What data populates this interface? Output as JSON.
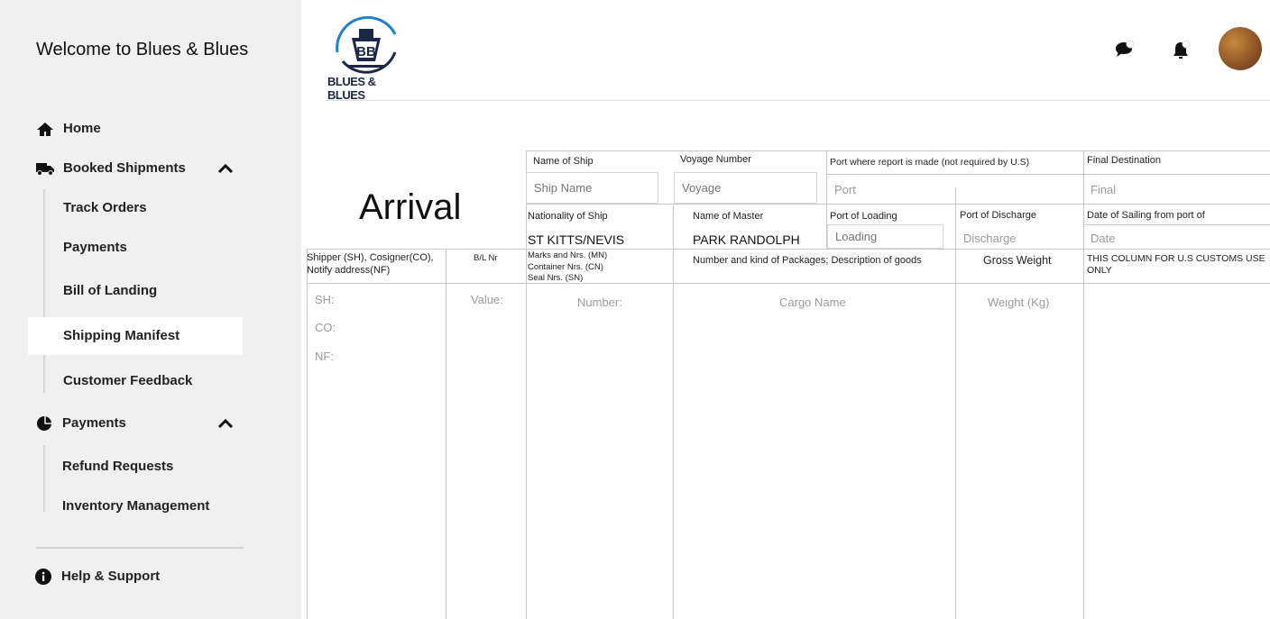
{
  "sidebar": {
    "welcome": "Welcome to Blues & Blues",
    "home": "Home",
    "booked_shipments": "Booked Shipments",
    "booked_children": [
      "Track Orders",
      "Payments",
      "Bill of Landing",
      "Shipping Manifest",
      "Customer Feedback"
    ],
    "payments": "Payments",
    "payments_children": [
      "Refund Requests",
      "Inventory Management"
    ],
    "help": "Help & Support",
    "active": "Shipping Manifest"
  },
  "header": {
    "logo_text": "BLUES & BLUES"
  },
  "form": {
    "title": "Arrival",
    "name_of_ship_label": "Name of Ship",
    "name_of_ship_ph": "Ship Name",
    "voyage_label": "Voyage Number",
    "voyage_ph": "Voyage",
    "port_report_label": "Port where report is made (not required by U.S)",
    "port_report_ph": "Port",
    "final_dest_label": "Final Destination",
    "final_dest_ph": "Final",
    "nationality_label": "Nationality of Ship",
    "nationality_value": "ST KITTS/NEVIS",
    "master_label": "Name of Master",
    "master_value": "PARK RANDOLPH",
    "loading_label": "Port of Loading",
    "loading_ph": "Loading",
    "discharge_label": "Port of Discharge",
    "discharge_ph": "Discharge",
    "sailing_label": "Date of Sailing from port of",
    "sailing_ph": "Date",
    "shipper_label": "Shipper (SH), Cosigner(CO), Notify address(NF)",
    "bl_label": "B/L Nr",
    "marks_label": [
      "Marks and Nrs. (MN)",
      "Container Nrs. (CN)",
      "Seal Nrs. (SN)"
    ],
    "packages_label": "Number and kind of Packages; Description of goods",
    "gross_label": "Gross Weight",
    "customs_label": "THIS COLUMN FOR U.S CUSTOMS USE ONLY",
    "sh_ph": "SH:",
    "co_ph": "CO:",
    "nf_ph": "NF:",
    "value_ph": "Value:",
    "number_ph": "Number:",
    "cargo_ph": "Cargo Name",
    "weight_ph": "Weight (Kg)"
  }
}
